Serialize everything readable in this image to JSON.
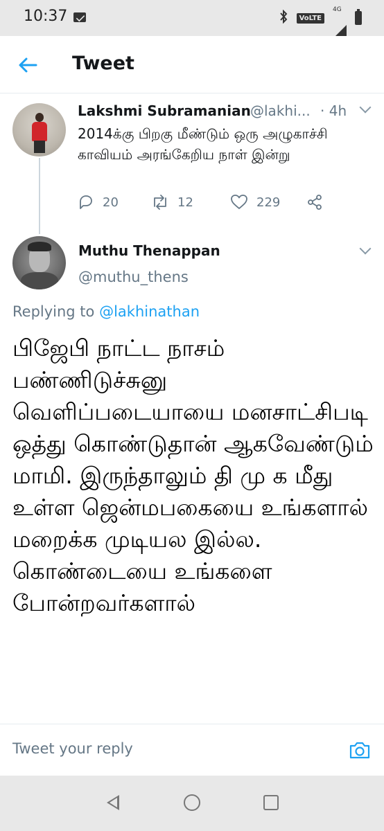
{
  "status_bar": {
    "time": "10:37",
    "network_badge": "VoLTE",
    "network_type": "4G"
  },
  "header": {
    "title": "Tweet"
  },
  "parent_tweet": {
    "author_name": "Lakshmi Subramanian",
    "handle": "@lakhi...",
    "time": "· 4h",
    "text": "2014க்கு பிறகு மீண்டும் ஒரு அழுகாச்சி காவியம் அரங்கேறிய நாள் இன்று",
    "replies": "20",
    "retweets": "12",
    "likes": "229"
  },
  "reply_tweet": {
    "author_name": "Muthu Thenappan",
    "handle": "@muthu_thens",
    "replying_label": "Replying to",
    "replying_to": "@lakhinathan",
    "text": "பிஜேபி நாட்ட நாசம் பண்ணிடுச்சுனு வெளிப்படையாயை மனசாட்சிபடி ஒத்து கொண்டுதான் ஆகவேண்டும் மாமி. இருந்தாலும் தி மு க மீது உள்ள ஜென்மபகையை உங்களால் மறைக்க முடியல இல்ல. கொண்டையை உங்களை போன்றவர்களால்"
  },
  "reply_bar": {
    "placeholder": "Tweet your reply"
  },
  "colors": {
    "accent": "#1da1f2",
    "secondary_text": "#657786",
    "divider": "#e6ecf0"
  }
}
